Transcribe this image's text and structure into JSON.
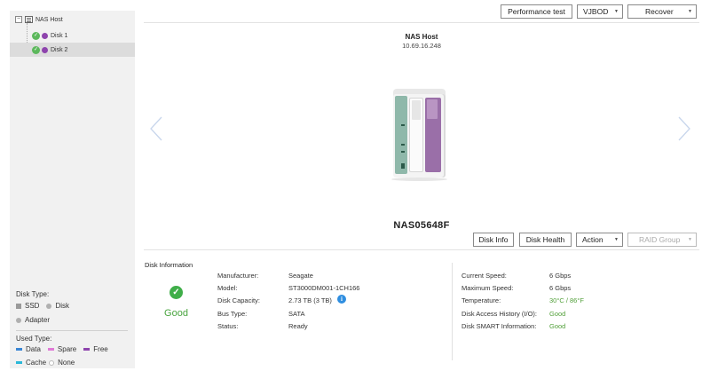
{
  "sidebar": {
    "tree": {
      "root_label": "NAS Host",
      "disks": [
        {
          "label": "Disk 1",
          "selected": false
        },
        {
          "label": "Disk 2",
          "selected": true
        }
      ]
    },
    "legend": {
      "disk_type_title": "Disk Type:",
      "disk_types": [
        "SSD",
        "Disk",
        "Adapter"
      ],
      "used_type_title": "Used Type:",
      "used_types": [
        {
          "label": "Data",
          "color": "#3a86d4"
        },
        {
          "label": "Spare",
          "color": "#e07ad6"
        },
        {
          "label": "Free",
          "color": "#8e44ad"
        },
        {
          "label": "Cache",
          "color": "#2bb8d9"
        },
        {
          "label": "None",
          "color": "#ffffff"
        }
      ]
    }
  },
  "toolbar": {
    "performance_test": "Performance test",
    "vjbod": "VJBOD",
    "recover": "Recover"
  },
  "device": {
    "host_name": "NAS Host",
    "ip": "10.69.16.248",
    "model": "NAS05648F"
  },
  "actions": {
    "disk_info": "Disk Info",
    "disk_health": "Disk Health",
    "action": "Action",
    "raid_group": "RAID Group"
  },
  "disk_information": {
    "title": "Disk Information",
    "status": "Good",
    "left": [
      {
        "label": "Manufacturer:",
        "value": "Seagate"
      },
      {
        "label": "Model:",
        "value": "ST3000DM001-1CH166"
      },
      {
        "label": "Disk Capacity:",
        "value": "2.73 TB (3 TB)"
      },
      {
        "label": "Bus Type:",
        "value": "SATA"
      },
      {
        "label": "Status:",
        "value": "Ready"
      }
    ],
    "right": [
      {
        "label": "Current Speed:",
        "value": "6 Gbps"
      },
      {
        "label": "Maximum Speed:",
        "value": "6 Gbps"
      },
      {
        "label": "Temperature:",
        "value": "30°C / 86°F"
      },
      {
        "label": "Disk Access History (I/O):",
        "value": "Good"
      },
      {
        "label": "Disk SMART Information:",
        "value": "Good"
      }
    ]
  },
  "colors": {
    "good_green": "#49a43f",
    "disk_purple": "#8e44ad",
    "info_blue": "#2f8ee0"
  }
}
